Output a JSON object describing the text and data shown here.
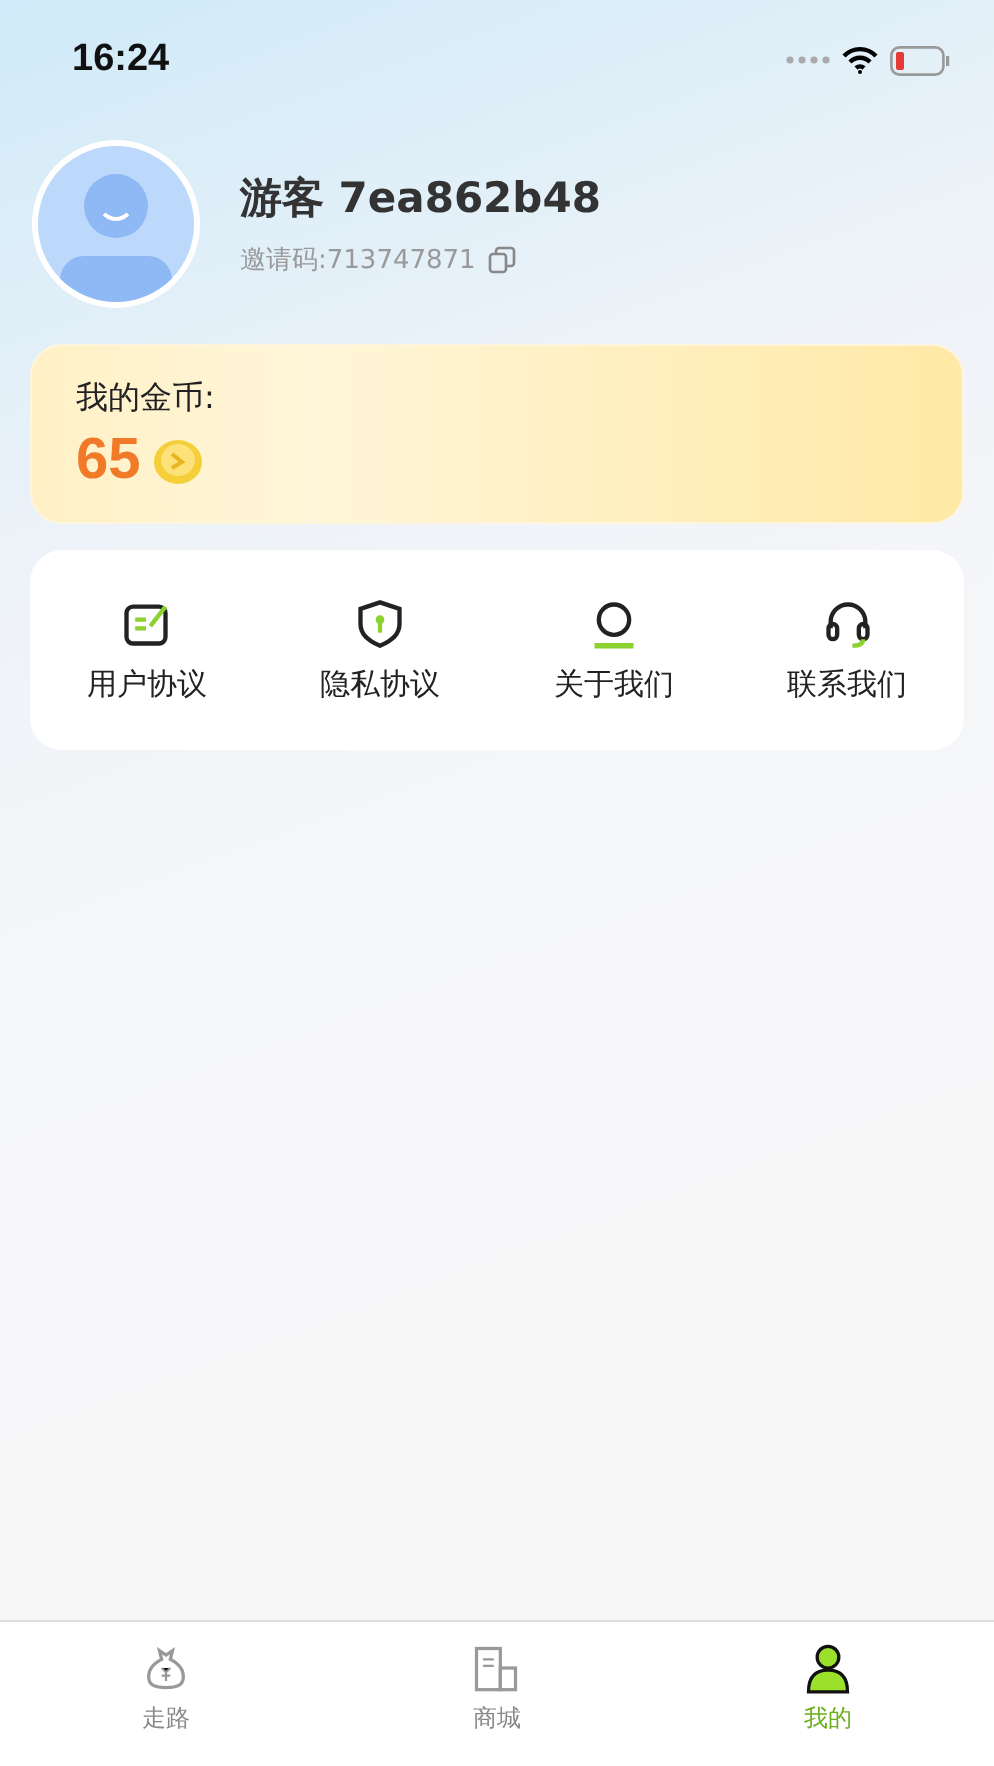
{
  "status_bar": {
    "time": "16:24"
  },
  "profile": {
    "name": "游客 7ea862b48",
    "invite_code": "邀请码:713747871"
  },
  "coins": {
    "label": "我的金币:",
    "amount": "65"
  },
  "menu": [
    {
      "label": "用户协议"
    },
    {
      "label": "隐私协议"
    },
    {
      "label": "关于我们"
    },
    {
      "label": "联系我们"
    }
  ],
  "tab_bar": [
    {
      "label": "走路",
      "selected": false
    },
    {
      "label": "商城",
      "selected": false
    },
    {
      "label": "我的",
      "selected": true
    }
  ]
}
